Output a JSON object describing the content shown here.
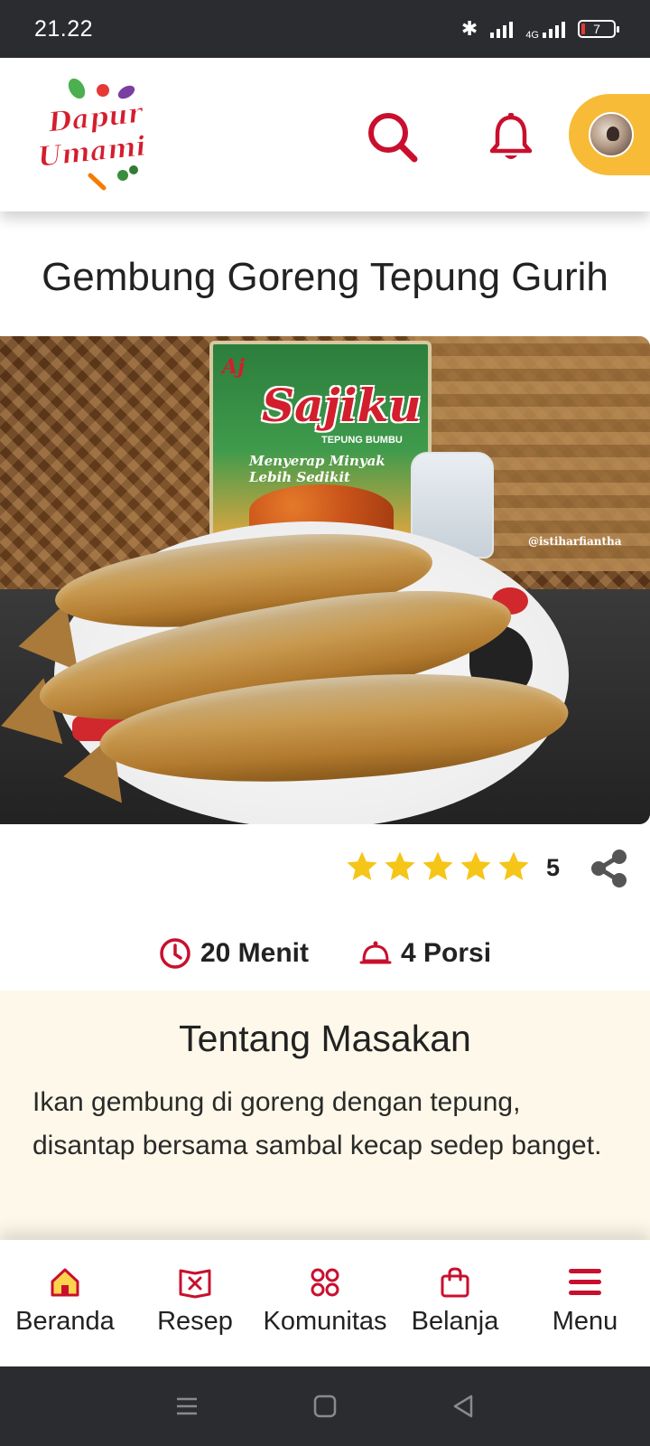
{
  "status_bar": {
    "time": "21.22",
    "network": "4G",
    "battery": "7"
  },
  "header": {
    "logo_line1": "Dapur",
    "logo_line2": "Umami",
    "search_icon": "search-icon",
    "bell_icon": "bell-icon"
  },
  "recipe": {
    "title": "Gembung Goreng Tepung Gurih",
    "photo": {
      "packet_maker": "Aj",
      "packet_brand": "Sajiku",
      "packet_sub": "TEPUNG BUMBU",
      "packet_tag": "Menyerap Minyak Lebih Sedikit",
      "watermark": "@istiharfiantha"
    },
    "rating": {
      "stars": 5,
      "value": "5"
    },
    "time": "20 Menit",
    "portions": "4 Porsi"
  },
  "about": {
    "title": "Tentang Masakan",
    "text": "Ikan gembung di goreng dengan tepung, disantap bersama sambal kecap sedep banget."
  },
  "bottom_nav": [
    {
      "label": "Beranda",
      "icon": "home-icon"
    },
    {
      "label": "Resep",
      "icon": "recipe-book-icon"
    },
    {
      "label": "Komunitas",
      "icon": "community-grid-icon"
    },
    {
      "label": "Belanja",
      "icon": "shopping-bag-icon"
    },
    {
      "label": "Menu",
      "icon": "hamburger-menu-icon"
    }
  ],
  "colors": {
    "accent": "#c8102e",
    "star": "#f5c518",
    "avatar_pill": "#f8bb37",
    "about_bg": "#fdf8e9",
    "system_bar": "#2b2c30"
  }
}
